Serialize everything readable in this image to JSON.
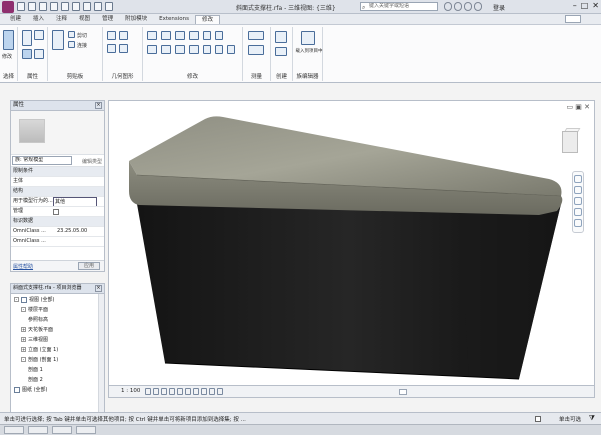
{
  "titlebar": {
    "title": "斜面式支撑柱.rfa - 三维视图: {三维}",
    "search_placeholder": "键入关键字或短语",
    "login_label": "登录",
    "window_controls": [
      "–",
      "□",
      "✕"
    ]
  },
  "tabs": [
    {
      "label": "创建",
      "active": false
    },
    {
      "label": "插入",
      "active": false
    },
    {
      "label": "注释",
      "active": false
    },
    {
      "label": "视图",
      "active": false
    },
    {
      "label": "管理",
      "active": false
    },
    {
      "label": "附加模块",
      "active": false
    },
    {
      "label": "Extensions",
      "active": false
    },
    {
      "label": "修改",
      "active": true
    }
  ],
  "ribbon": {
    "modify_label": "修改",
    "groups": [
      {
        "label": "选择"
      },
      {
        "label": "属性"
      },
      {
        "label": "剪贴板"
      },
      {
        "label": "几何图形"
      },
      {
        "label": "修改"
      },
      {
        "label": "测量"
      },
      {
        "label": "创建"
      },
      {
        "label": "族编辑器"
      }
    ],
    "clipboard_cut": "剪切",
    "clipboard_join": "连接",
    "family_editor_label": "载入到项目中"
  },
  "properties": {
    "title": "属性",
    "type_selector": "族: 常规模型",
    "edit_type": "编辑类型",
    "rows": [
      {
        "label": "限制条件",
        "kind": "cat"
      },
      {
        "label": "主体",
        "value": "",
        "kind": "row"
      },
      {
        "label": "结构",
        "kind": "cat"
      },
      {
        "label": "用于模型行为的...",
        "value": "其他",
        "kind": "box"
      },
      {
        "label": "管理",
        "value": "",
        "kind": "check"
      },
      {
        "label": "标识数据",
        "kind": "cat"
      },
      {
        "label": "OmniClass ...",
        "value": "23.25.05.00",
        "kind": "row"
      },
      {
        "label": "OmniClass ...",
        "value": "",
        "kind": "row"
      }
    ],
    "help_link": "属性帮助",
    "apply_label": "应用"
  },
  "browser": {
    "title": "斜面式支撑柱.rfa - 项目浏览器",
    "items": [
      {
        "label": "视图 (全部)",
        "indent": 0,
        "exp": "-"
      },
      {
        "label": "楼层平面",
        "indent": 1,
        "exp": "-"
      },
      {
        "label": "参照标高",
        "indent": 2,
        "exp": ""
      },
      {
        "label": "天花板平面",
        "indent": 1,
        "exp": "+"
      },
      {
        "label": "三维视图",
        "indent": 1,
        "exp": "+"
      },
      {
        "label": "立面 (立面 1)",
        "indent": 1,
        "exp": "+"
      },
      {
        "label": "剖面 (剖面 1)",
        "indent": 1,
        "exp": "-"
      },
      {
        "label": "剖面 1",
        "indent": 2,
        "exp": ""
      },
      {
        "label": "剖面 2",
        "indent": 2,
        "exp": ""
      },
      {
        "label": "图纸 (全部)",
        "indent": 0,
        "exp": ""
      }
    ]
  },
  "viewport": {
    "controls": "▭ ▣ ✕"
  },
  "viewbar": {
    "scale": "1 : 100"
  },
  "status": {
    "text": "单击可进行选择; 按 Tab 键并单击可选择其他项目; 按 Ctrl 键并单击可将新项目添加到选择集; 按 ...",
    "filter_label": "单击可选"
  },
  "colors": {
    "concrete_light": "#9a9a8c",
    "concrete_dark": "#6e6e63",
    "body_dark": "#1c1c1c",
    "body_mid": "#2a2a2a"
  }
}
